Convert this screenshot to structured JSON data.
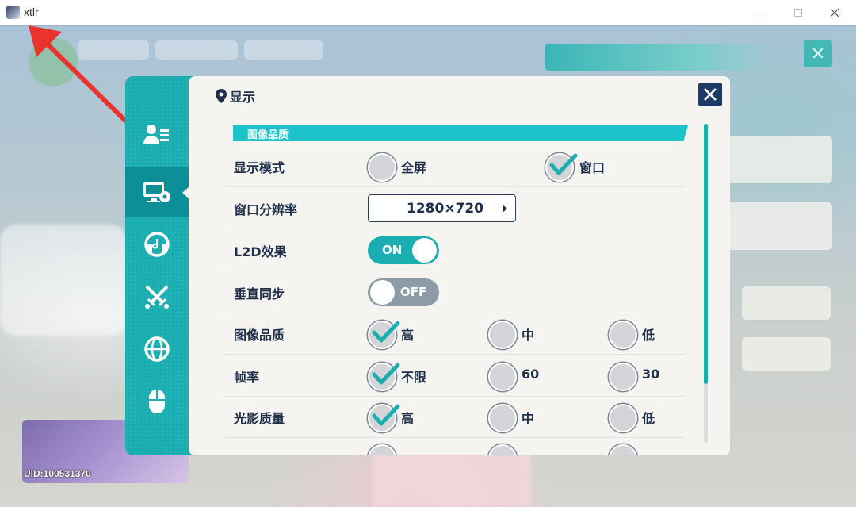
{
  "window": {
    "title": "xtlr",
    "min_icon": "minimize-icon",
    "max_icon": "maximize-icon",
    "close_icon": "close-icon"
  },
  "game": {
    "uid": "UID:100531370"
  },
  "settings": {
    "accent": "#1aaeb1",
    "sidebar": [
      {
        "icon": "profile-list-icon",
        "active": false
      },
      {
        "icon": "monitor-gear-icon",
        "active": true
      },
      {
        "icon": "headphones-icon",
        "active": false
      },
      {
        "icon": "crossed-swords-icon",
        "active": false
      },
      {
        "icon": "globe-icon",
        "active": false
      },
      {
        "icon": "mouse-icon",
        "active": false
      },
      {
        "icon": "more-icon",
        "active": false
      }
    ],
    "panel_title": "显示",
    "section_title": "图像品质",
    "display_mode": {
      "label": "显示模式",
      "options": [
        "全屏",
        "窗口"
      ],
      "selected": "窗口"
    },
    "resolution": {
      "label": "窗口分辨率",
      "value": "1280×720"
    },
    "l2d": {
      "label": "L2D效果",
      "state": "ON"
    },
    "vsync": {
      "label": "垂直同步",
      "state": "OFF"
    },
    "image_quality": {
      "label": "图像品质",
      "options": [
        "高",
        "中",
        "低"
      ],
      "selected": "高"
    },
    "frame_rate": {
      "label": "帧率",
      "options": [
        "不限",
        "60",
        "30"
      ],
      "selected": "不限"
    },
    "shadow_quality": {
      "label": "光影质量",
      "options": [
        "高",
        "中",
        "低"
      ],
      "selected": "高"
    }
  }
}
